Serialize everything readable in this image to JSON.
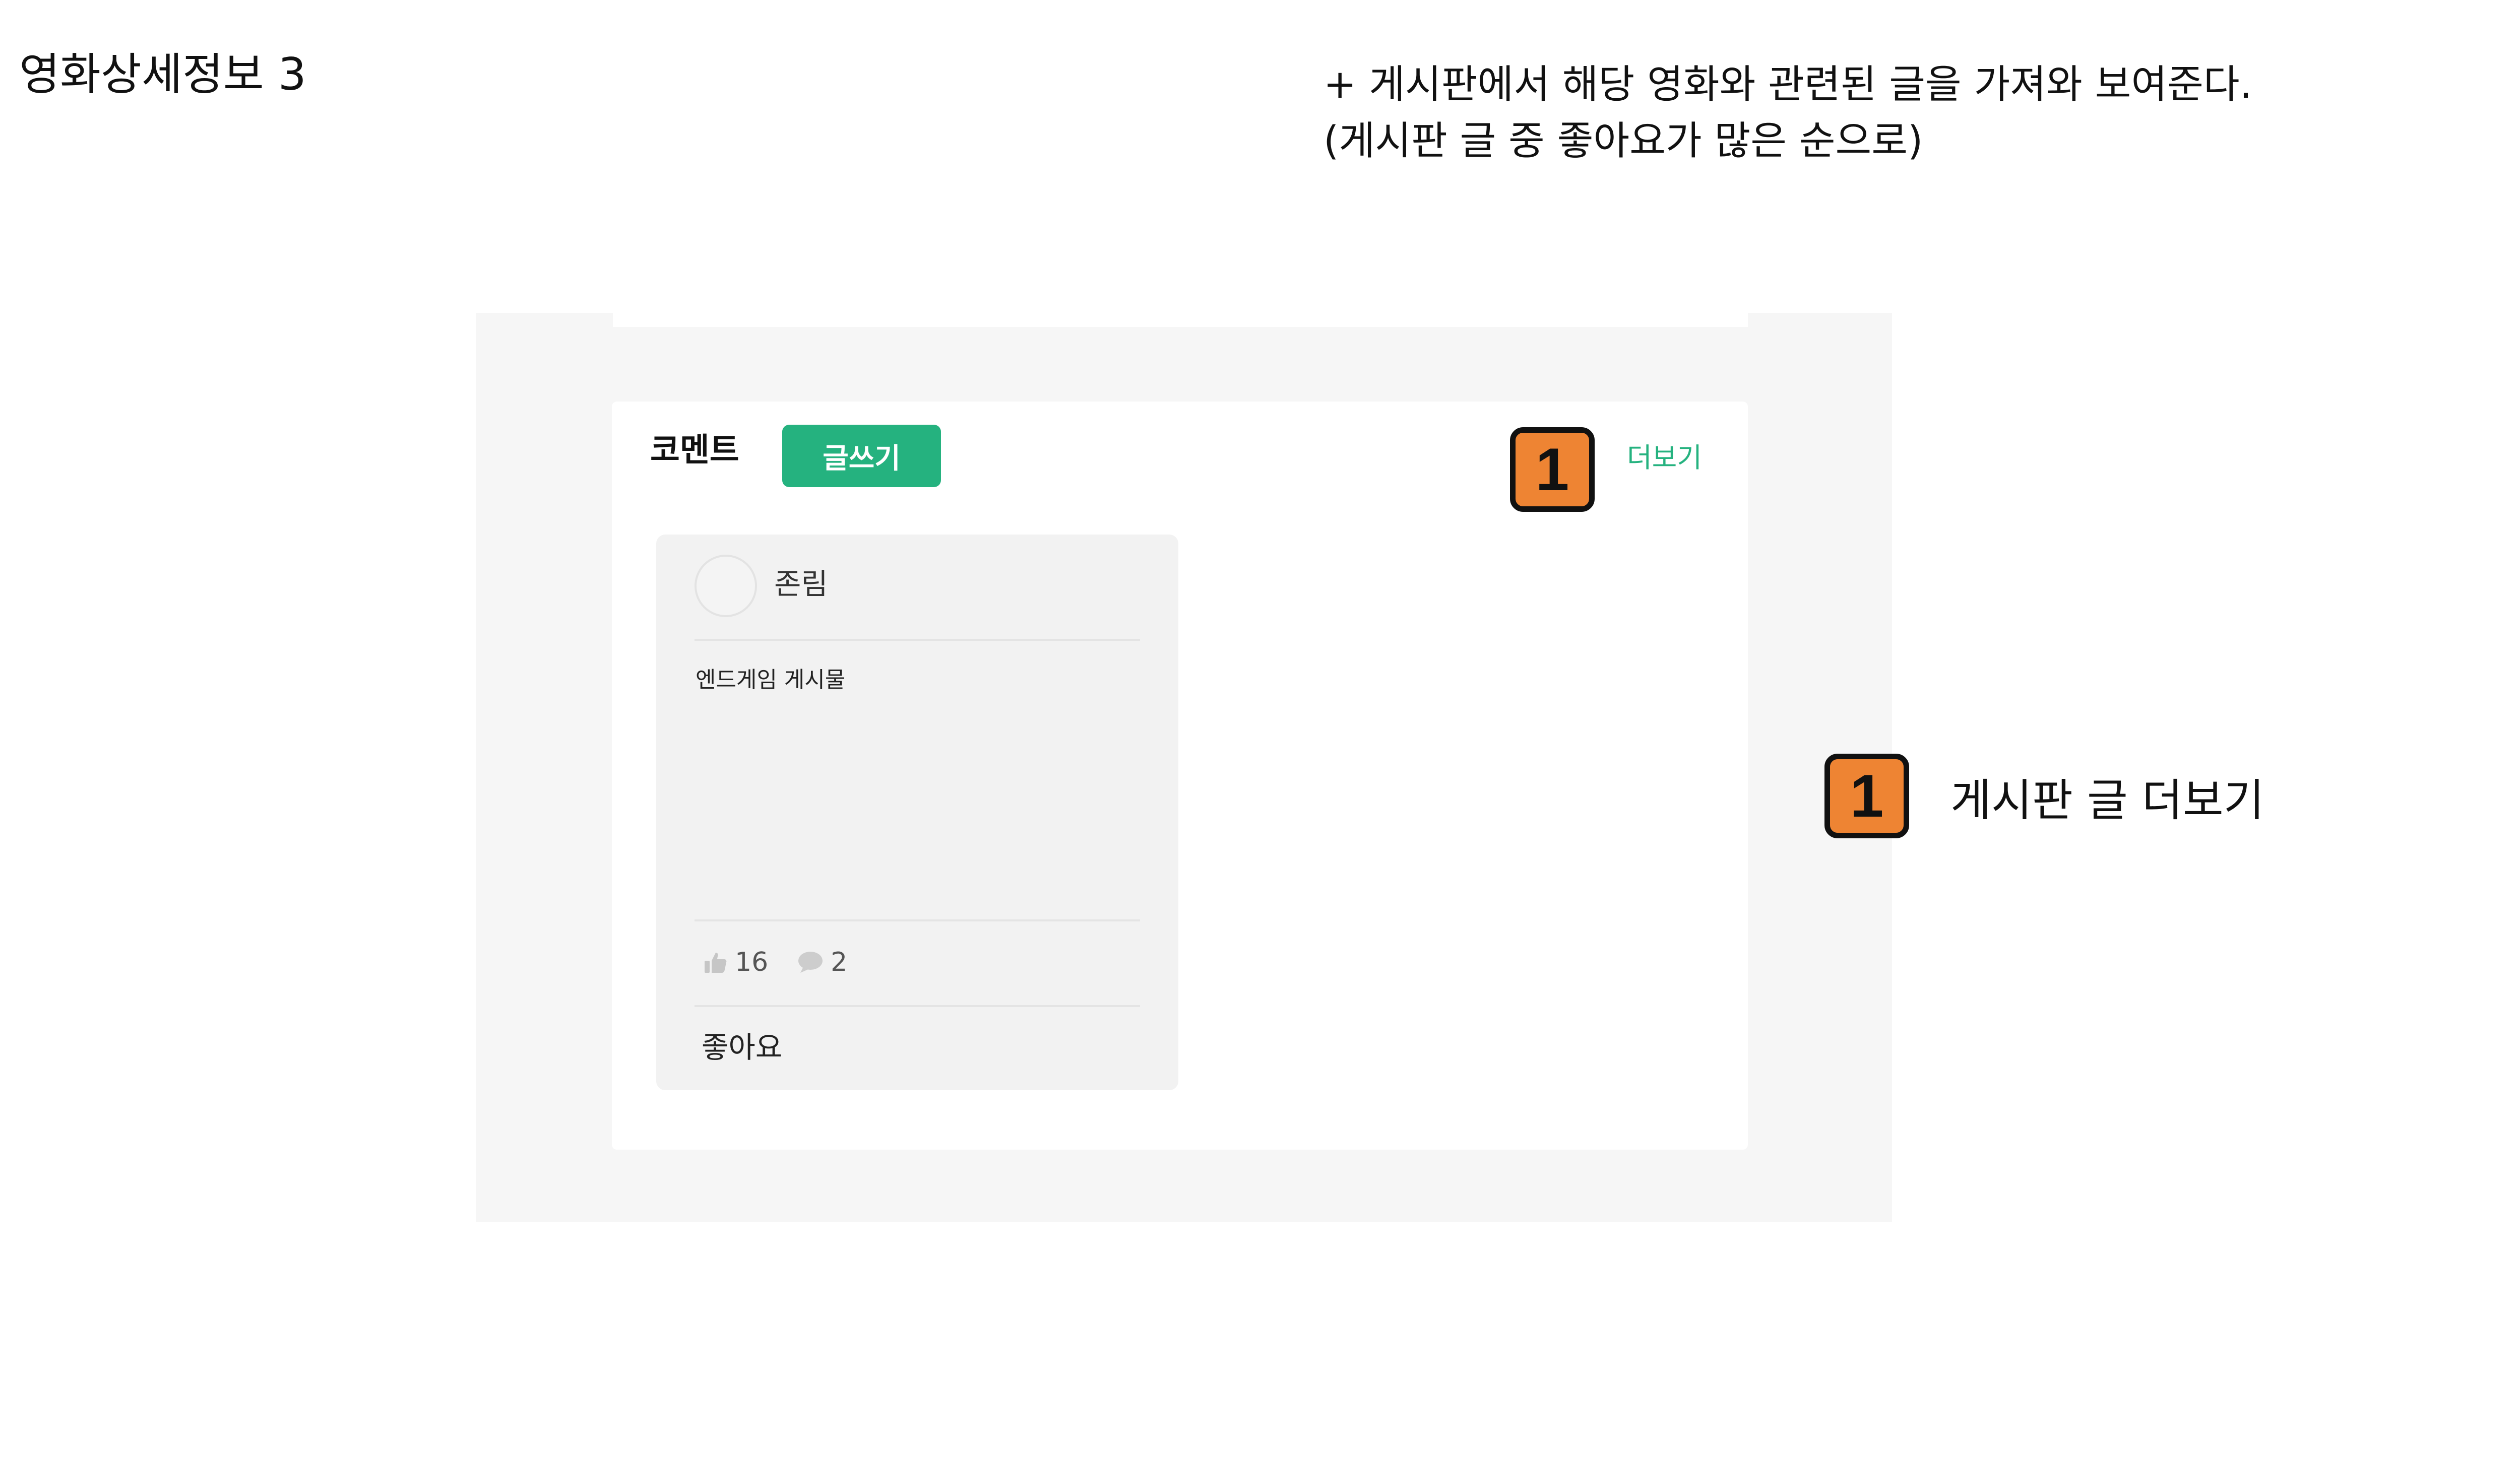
{
  "slide": {
    "title": "영화상세정보 3",
    "description": [
      "+ 게시판에서 해당 영화와 관련된 글을 가져와 보여준다.",
      "(게시판 글 중 좋아요가 많은 순으로)"
    ]
  },
  "section": {
    "heading": "코멘트",
    "write_button": "글쓰기",
    "more_link": "더보기"
  },
  "card": {
    "author": "존림",
    "post_title": "엔드게임 게시물",
    "like_count": "16",
    "comment_count": "2",
    "like_label": "좋아요",
    "icons": {
      "like": "thumbs-up-icon",
      "comment": "speech-bubble-icon"
    }
  },
  "annotation": {
    "badge_number": "1",
    "badge_color": "#ee8433",
    "callout": "게시판 글 더보기"
  },
  "colors": {
    "accent": "#25b27f",
    "frame_background": "#f6f6f6",
    "card_background": "#f2f2f2"
  }
}
